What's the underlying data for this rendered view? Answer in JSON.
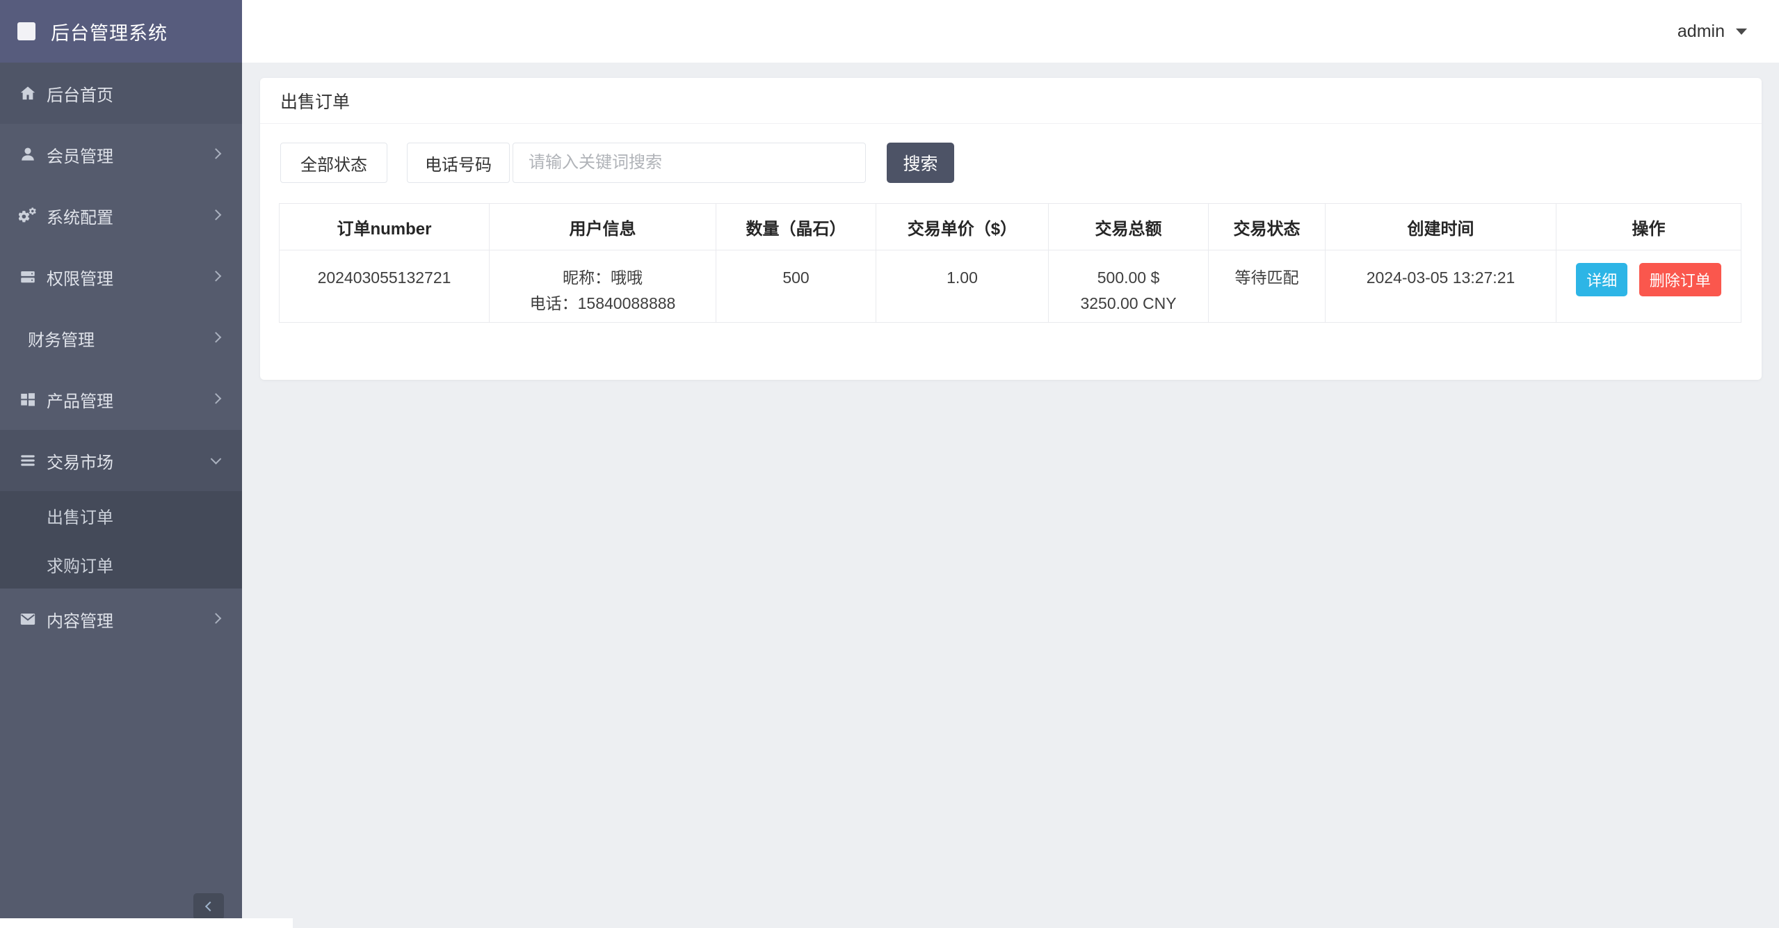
{
  "app": {
    "title": "后台管理系统"
  },
  "topbar": {
    "username": "admin"
  },
  "sidebar": {
    "items": [
      {
        "label": "后台首页",
        "icon": "home-icon"
      },
      {
        "label": "会员管理",
        "icon": "user-icon",
        "chevron": "right"
      },
      {
        "label": "系统配置",
        "icon": "gears-icon",
        "chevron": "right"
      },
      {
        "label": "权限管理",
        "icon": "server-icon",
        "chevron": "right"
      },
      {
        "label": "财务管理",
        "icon": null,
        "chevron": "right"
      },
      {
        "label": "产品管理",
        "icon": "grid-icon",
        "chevron": "right"
      },
      {
        "label": "交易市场",
        "icon": "menu-bars-icon",
        "chevron": "down",
        "expanded": true,
        "children": [
          {
            "label": "出售订单",
            "active": true
          },
          {
            "label": "求购订单"
          }
        ]
      },
      {
        "label": "内容管理",
        "icon": "mail-icon",
        "chevron": "right"
      }
    ]
  },
  "panel": {
    "title": "出售订单",
    "filters": {
      "status_select": "全部状态",
      "phone_select": "电话号码",
      "keyword_placeholder": "请输入关键词搜索",
      "search_button": "搜索"
    },
    "table": {
      "headers": [
        "订单number",
        "用户信息",
        "数量（晶石）",
        "交易单价（$）",
        "交易总额",
        "交易状态",
        "创建时间",
        "操作"
      ],
      "rows": [
        {
          "order_no": "202403055132721",
          "user_nickname": "昵称：哦哦",
          "user_phone": "电话：15840088888",
          "quantity": "500",
          "unit_price": "1.00",
          "total_usd": "500.00 $",
          "total_cny": "3250.00 CNY",
          "status": "等待匹配",
          "created_at": "2024-03-05 13:27:21",
          "detail_button": "详细",
          "delete_button": "删除订单"
        }
      ]
    }
  },
  "colors": {
    "sidebar_header": "#575c7d",
    "sidebar_base": "#555b6d",
    "sidebar_submenu": "#444a59",
    "page_background": "#edeff2",
    "search_button": "#4d5366",
    "detail_button": "#2db5e6",
    "delete_button": "#fa574d"
  }
}
